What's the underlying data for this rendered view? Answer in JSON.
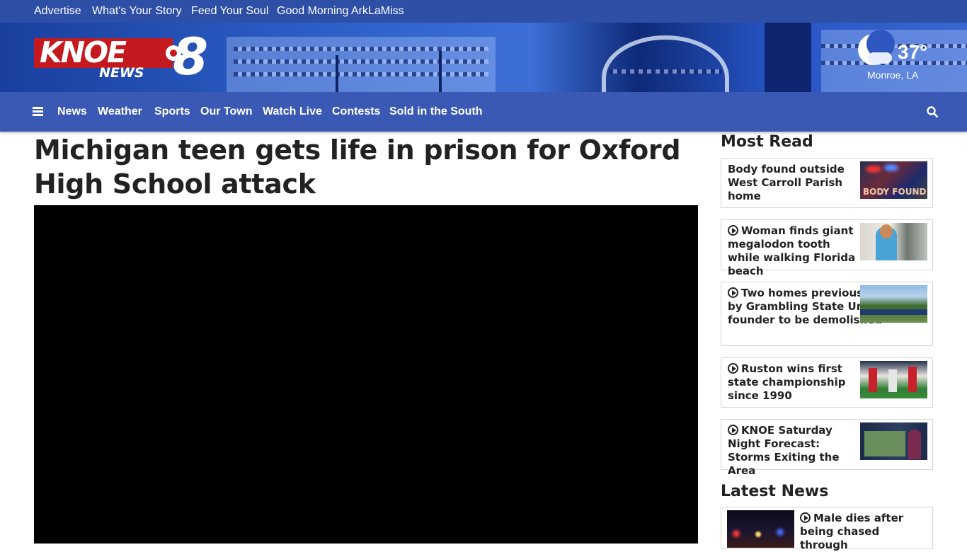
{
  "topbar": {
    "links": [
      "Advertise",
      "What's Your Story",
      "Feed Your Soul",
      "Good Morning ArkLaMiss"
    ]
  },
  "logo": {
    "knoe": "KNOE",
    "news": "NEWS",
    "eight": "8"
  },
  "weather": {
    "temp": "37°",
    "location": "Monroe, LA",
    "icon": "moon-cloud-icon"
  },
  "nav": {
    "items": [
      "News",
      "Weather",
      "Sports",
      "Our Town",
      "Watch Live",
      "Contests",
      "Sold in the South"
    ]
  },
  "article": {
    "headline": "Michigan teen gets life in prison for Oxford High School attack"
  },
  "sidebar": {
    "most_read_title": "Most Read",
    "latest_news_title": "Latest News",
    "most_read": [
      {
        "title": "Body found outside West Carroll Parish home",
        "video": false,
        "thumb_text": "BODY FOUND"
      },
      {
        "title": "Woman finds giant megalodon tooth while walking Florida beach",
        "video": true
      },
      {
        "title": "Two homes previously owned by Grambling State University founder to be demolished",
        "video": true
      },
      {
        "title": "Ruston wins first state championship since 1990",
        "video": true
      },
      {
        "title": "KNOE Saturday Night Forecast: Storms Exiting the Area",
        "video": true
      }
    ],
    "latest": [
      {
        "title": "Male dies after being chased through",
        "video": true
      }
    ]
  },
  "colors": {
    "topbar": "#2e4fa6",
    "nav": "#3a59b4",
    "logo_red": "#c41a1f"
  }
}
